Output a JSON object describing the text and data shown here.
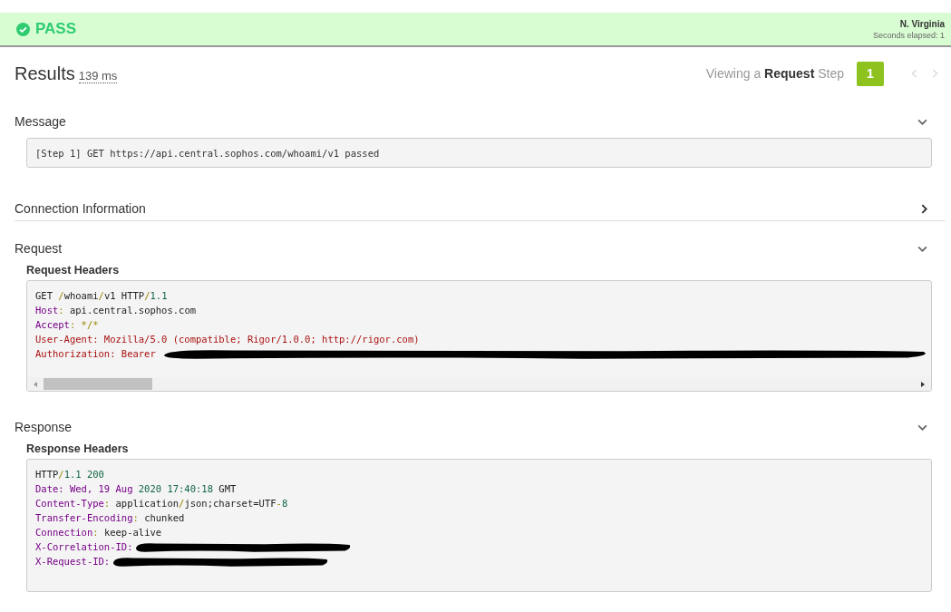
{
  "banner": {
    "status": "PASS",
    "passed": true,
    "location": "N. Virginia",
    "elapsed": "Seconds elapsed: 1"
  },
  "results": {
    "title": "Results",
    "duration": "139 ms",
    "viewing": "Viewing a **Request** Step",
    "steps": [
      {
        "label": "1",
        "selected": true
      }
    ],
    "prev_disabled": true,
    "next_disabled": true
  },
  "sections": [
    {
      "kind": "message",
      "title": "Message",
      "expanded": true,
      "text": "[Step 1] GET https://api.central.sophos.com/whoami/v1 passed"
    },
    {
      "kind": "plain",
      "title": "Connection Information",
      "expanded": false
    },
    {
      "kind": "headers",
      "title": "Request",
      "expanded": true,
      "subtitle": "Request Headers",
      "scrollbar": true,
      "lines": [
        {
          "redacted": false,
          "tokens": [
            {
              "kind": "plain",
              "text": "GET "
            },
            {
              "kind": "punct",
              "text": "/"
            },
            {
              "kind": "plain",
              "text": "whoami"
            },
            {
              "kind": "punct",
              "text": "/"
            },
            {
              "kind": "plain",
              "text": "v1 HTTP"
            },
            {
              "kind": "punct",
              "text": "/"
            },
            {
              "kind": "num",
              "text": "1.1"
            }
          ]
        },
        {
          "redacted": false,
          "tokens": [
            {
              "kind": "key",
              "text": "Host"
            },
            {
              "kind": "punct",
              "text": ": "
            },
            {
              "kind": "plain",
              "text": "api.central.sophos.com"
            }
          ]
        },
        {
          "redacted": false,
          "tokens": [
            {
              "kind": "key",
              "text": "Accept"
            },
            {
              "kind": "punct",
              "text": ": */*"
            }
          ]
        },
        {
          "redacted": false,
          "tokens": [
            {
              "kind": "red",
              "text": "User-Agent: Mozilla/5.0 (compatible; Rigor/1.0.0; http://rigor.com)"
            }
          ]
        },
        {
          "redacted": true,
          "tokens": [
            {
              "kind": "red",
              "text": "Authorization: Bearer"
            }
          ]
        }
      ]
    },
    {
      "kind": "headers",
      "title": "Response",
      "expanded": true,
      "subtitle": "Response Headers",
      "scrollbar": false,
      "lines": [
        {
          "redacted": false,
          "tokens": [
            {
              "kind": "plain",
              "text": "HTTP"
            },
            {
              "kind": "punct",
              "text": "/"
            },
            {
              "kind": "num",
              "text": "1.1 200"
            }
          ]
        },
        {
          "redacted": false,
          "tokens": [
            {
              "kind": "key",
              "text": "Date: Wed, 19 Aug "
            },
            {
              "kind": "num",
              "text": "2020 17:40:18"
            },
            {
              "kind": "plain",
              "text": " GMT"
            }
          ]
        },
        {
          "redacted": false,
          "tokens": [
            {
              "kind": "key",
              "text": "Content-Type"
            },
            {
              "kind": "punct",
              "text": ": "
            },
            {
              "kind": "plain",
              "text": "application"
            },
            {
              "kind": "punct",
              "text": "/"
            },
            {
              "kind": "plain",
              "text": "json;charset=UTF"
            },
            {
              "kind": "punct",
              "text": "-"
            },
            {
              "kind": "num",
              "text": "8"
            }
          ]
        },
        {
          "redacted": false,
          "tokens": [
            {
              "kind": "key",
              "text": "Transfer-Encoding"
            },
            {
              "kind": "punct",
              "text": ": "
            },
            {
              "kind": "plain",
              "text": "chunked"
            }
          ]
        },
        {
          "redacted": false,
          "tokens": [
            {
              "kind": "key",
              "text": "Connection"
            },
            {
              "kind": "punct",
              "text": ": "
            },
            {
              "kind": "plain",
              "text": "keep-alive"
            }
          ]
        },
        {
          "redacted": true,
          "tokens": [
            {
              "kind": "key",
              "text": "X-Correlation-ID:"
            }
          ]
        },
        {
          "redacted": true,
          "tokens": [
            {
              "kind": "key",
              "text": "X-Request-ID:"
            }
          ]
        }
      ]
    }
  ]
}
